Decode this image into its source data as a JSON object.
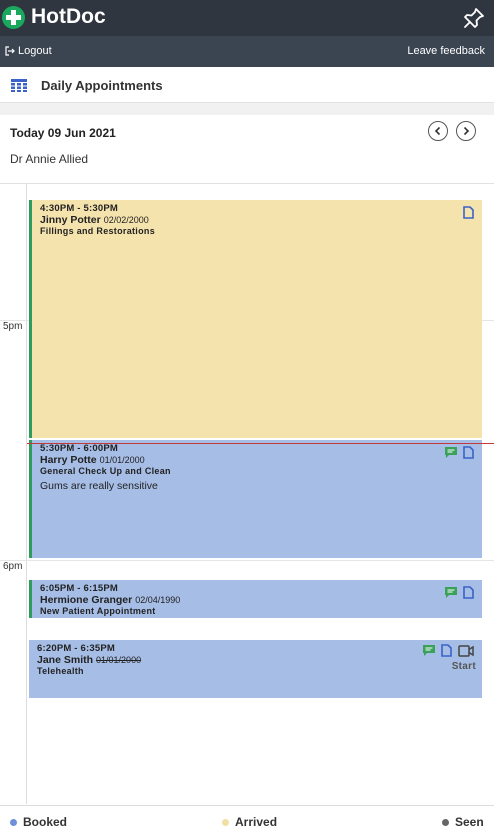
{
  "app": {
    "name": "HotDoc"
  },
  "subbar": {
    "logout": "Logout",
    "feedback": "Leave feedback"
  },
  "page": {
    "title": "Daily Appointments"
  },
  "date": {
    "label": "Today 09 Jun 2021",
    "practitioner": "Dr Annie Allied"
  },
  "hours": [
    "5pm",
    "6pm"
  ],
  "appointments": [
    {
      "time": "4:30PM - 5:30PM",
      "name": "Jinny Potter",
      "dob": "02/02/2000",
      "type": "Fillings and Restorations",
      "note": "",
      "status": "arrived",
      "icons": [
        "document-icon"
      ]
    },
    {
      "time": "5:30PM - 6:00PM",
      "name": "Harry Potte",
      "dob": "01/01/2000",
      "type": "General Check Up and Clean",
      "note": "Gums are really sensitive",
      "status": "booked",
      "icons": [
        "message-icon",
        "document-icon"
      ]
    },
    {
      "time": "6:05PM - 6:15PM",
      "name": "Hermione Granger",
      "dob": "02/04/1990",
      "type": "New Patient Appointment",
      "note": "",
      "status": "booked",
      "icons": [
        "message-icon",
        "document-icon"
      ]
    },
    {
      "time": "6:20PM - 6:35PM",
      "name": "Jane Smith",
      "dob": "01/01/2000",
      "type": "Telehealth",
      "note": "",
      "status": "booked",
      "icons": [
        "message-icon",
        "document-icon",
        "video-icon"
      ],
      "action": "Start"
    }
  ],
  "legend": [
    {
      "label": "Booked",
      "color": "#6f8fd6"
    },
    {
      "label": "Arrived",
      "color": "#f2dfa3"
    },
    {
      "label": "Seen",
      "color": "#666666"
    }
  ],
  "colors": {
    "header": "#2f3640",
    "subbar": "#3b4451",
    "booked": "#a6bde6",
    "arrived": "#f5e3ae",
    "arrived_stripe": "#2e9c5c",
    "now_line": "#c43a3a",
    "icon_blue": "#3a62c9",
    "icon_green": "#3aa05a"
  }
}
